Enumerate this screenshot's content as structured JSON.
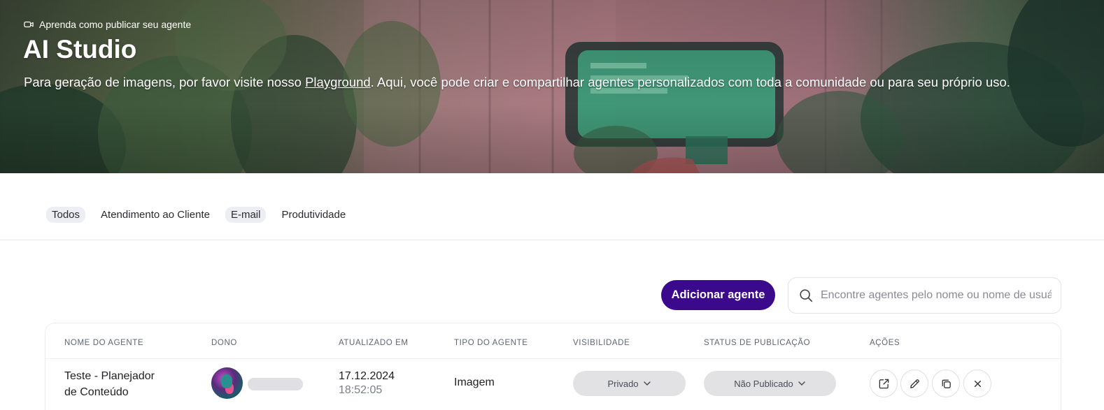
{
  "hero": {
    "learn_link": "Aprenda como publicar seu agente",
    "title": "AI Studio",
    "desc_before": "Para geração de imagens, por favor visite nosso ",
    "desc_link": "Playground",
    "desc_after": ". Aqui, você pode criar e compartilhar agentes personalizados com toda a comunidade ou para seu próprio uso."
  },
  "tabs": [
    {
      "label": "Todos",
      "active": true
    },
    {
      "label": "Atendimento ao Cliente",
      "active": false
    },
    {
      "label": "E-mail",
      "active": false
    },
    {
      "label": "Produtividade",
      "active": false
    }
  ],
  "toolbar": {
    "add_label": "Adicionar agente",
    "search_placeholder": "Encontre agentes pelo nome ou nome de usuário"
  },
  "table": {
    "headers": [
      "NOME DO AGENTE",
      "DONO",
      "ATUALIZADO EM",
      "TIPO DO AGENTE",
      "VISIBILIDADE",
      "STATUS DE PUBLICAÇÃO",
      "AÇÕES"
    ],
    "rows": [
      {
        "name_line1": "Teste - Planejador",
        "name_line2": "de Conteúdo",
        "date": "17.12.2024",
        "time": "18:52:05",
        "type": "Imagem",
        "visibility": "Privado",
        "publish_status": "Não Publicado"
      }
    ]
  },
  "icons": {
    "learn": "video-camera-icon",
    "search": "search-icon",
    "actions": [
      "open-external-icon",
      "edit-pencil-icon",
      "duplicate-icon",
      "close-icon"
    ]
  },
  "colors": {
    "primary_button": "#3b0a8c",
    "pill_bg": "#e2e2e5"
  }
}
